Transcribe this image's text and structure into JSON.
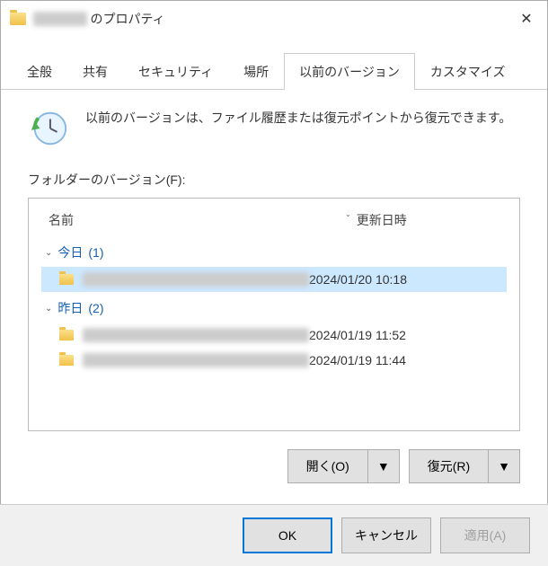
{
  "titlebar": {
    "folder_name": "██████",
    "suffix": "のプロパティ"
  },
  "tabs": {
    "general": "全般",
    "sharing": "共有",
    "security": "セキュリティ",
    "location": "場所",
    "previous_versions": "以前のバージョン",
    "customize": "カスタマイズ"
  },
  "intro": "以前のバージョンは、ファイル履歴または復元ポイントから復元できます。",
  "list_label": "フォルダーのバージョン(F):",
  "columns": {
    "name": "名前",
    "date": "更新日時"
  },
  "groups": [
    {
      "label": "今日",
      "count": "(1)",
      "items": [
        {
          "name": "███████",
          "date": "2024/01/20 10:18",
          "selected": true
        }
      ]
    },
    {
      "label": "昨日",
      "count": "(2)",
      "items": [
        {
          "name": "███████",
          "date": "2024/01/19 11:52",
          "selected": false
        },
        {
          "name": "███████",
          "date": "2024/01/19 11:44",
          "selected": false
        }
      ]
    }
  ],
  "actions": {
    "open": "開く(O)",
    "restore": "復元(R)"
  },
  "footer": {
    "ok": "OK",
    "cancel": "キャンセル",
    "apply": "適用(A)"
  }
}
